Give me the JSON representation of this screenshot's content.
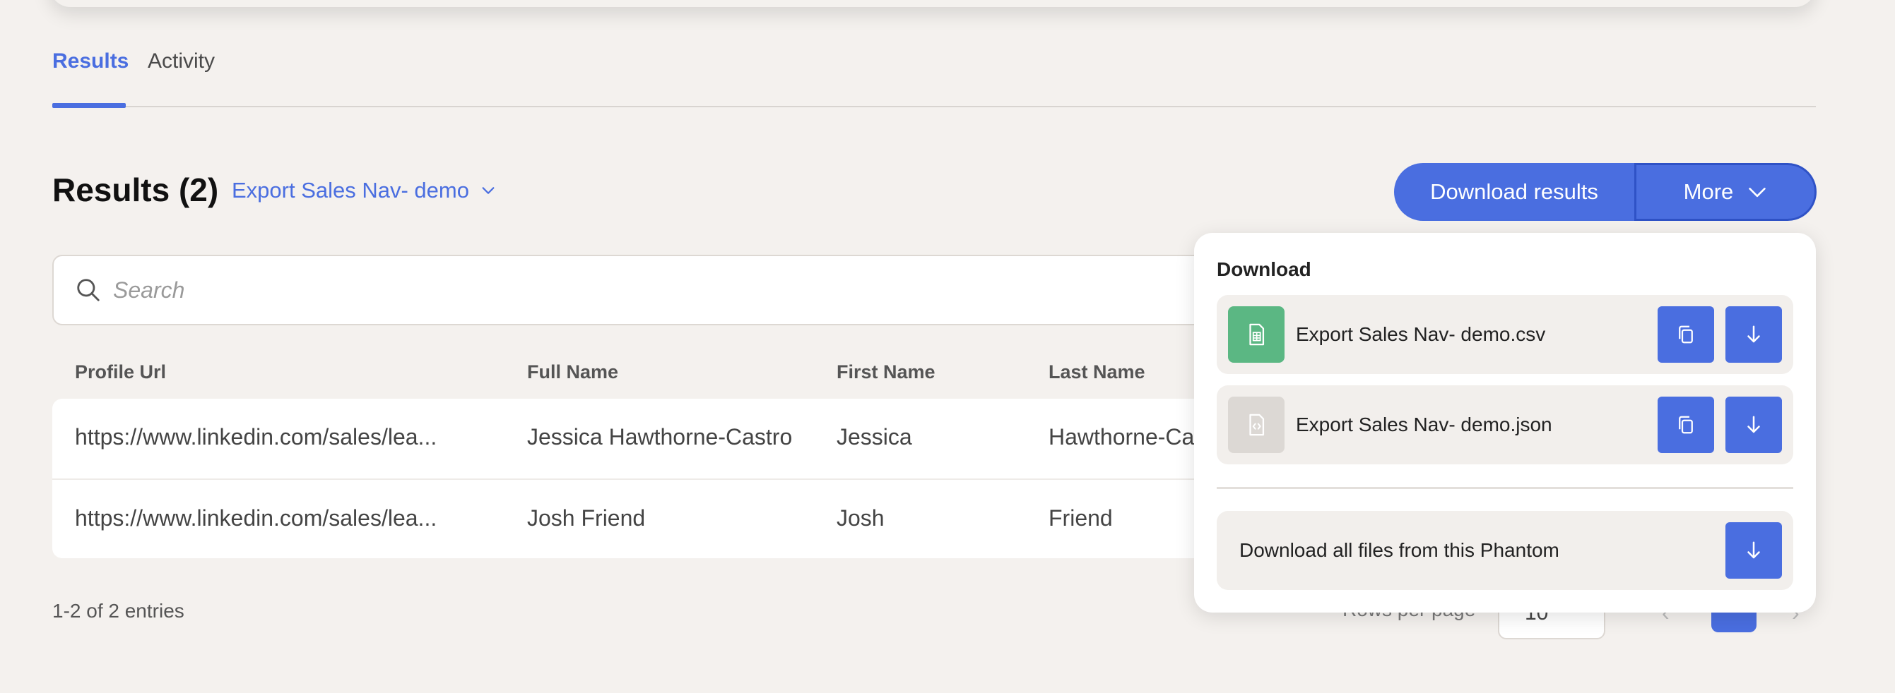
{
  "tabs": [
    {
      "label": "Results",
      "active": true
    },
    {
      "label": "Activity",
      "active": false
    }
  ],
  "results": {
    "heading": "Results (2)",
    "selector_label": "Export Sales Nav- demo",
    "download_button": "Download results",
    "more_button": "More"
  },
  "search": {
    "placeholder": "Search"
  },
  "table": {
    "columns": [
      "Profile Url",
      "Full Name",
      "First Name",
      "Last Name"
    ],
    "rows": [
      [
        "https://www.linkedin.com/sales/lea...",
        "Jessica Hawthorne-Castro",
        "Jessica",
        "Hawthorne-Ca"
      ],
      [
        "https://www.linkedin.com/sales/lea...",
        "Josh Friend",
        "Josh",
        "Friend"
      ]
    ]
  },
  "footer": {
    "entries": "1-2 of 2 entries",
    "rows_per_page_label": "Rows per page",
    "rows_per_page_value": "10"
  },
  "dropdown": {
    "title": "Download",
    "files": [
      {
        "name": "Export Sales Nav- demo.csv",
        "icon": "spreadsheet-file-icon",
        "icon_bg": "#5bb783"
      },
      {
        "name": "Export Sales Nav- demo.json",
        "icon": "code-file-icon",
        "icon_bg": "#dcd8d4"
      }
    ],
    "all_label": "Download all files from this Phantom"
  },
  "colors": {
    "accent": "#4a6ee0",
    "background": "#f4f1ee"
  }
}
